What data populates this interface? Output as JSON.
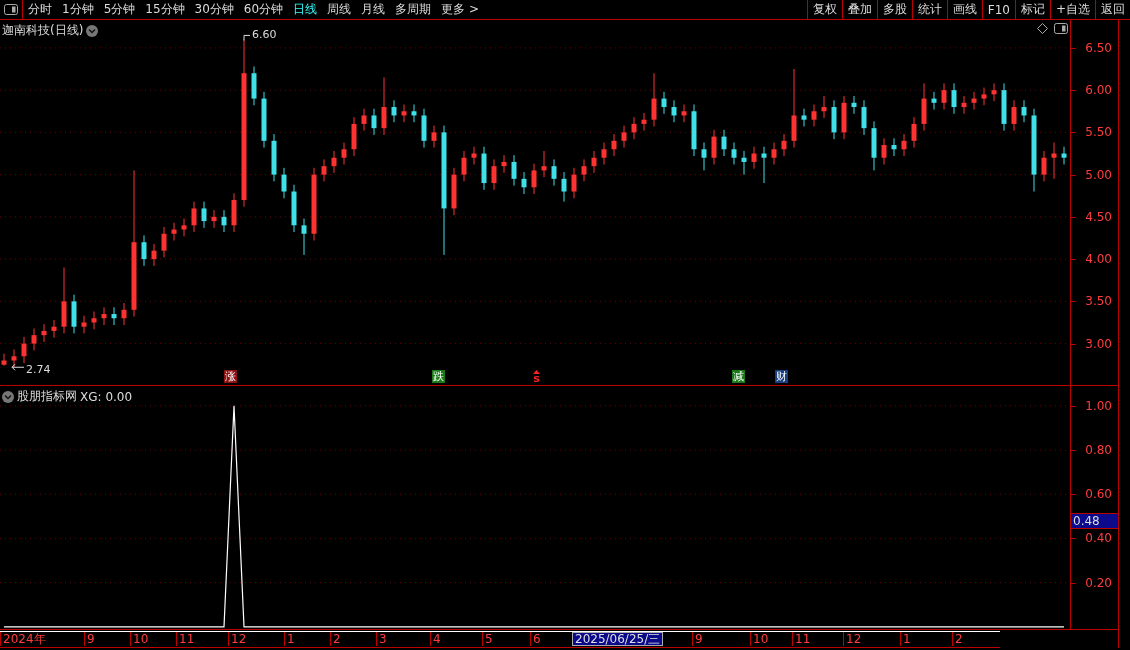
{
  "toolbar": {
    "periods": [
      {
        "label": "分时",
        "selected": false
      },
      {
        "label": "1分钟",
        "selected": false
      },
      {
        "label": "5分钟",
        "selected": false
      },
      {
        "label": "15分钟",
        "selected": false
      },
      {
        "label": "30分钟",
        "selected": false
      },
      {
        "label": "60分钟",
        "selected": false
      },
      {
        "label": "日线",
        "selected": true
      },
      {
        "label": "周线",
        "selected": false
      },
      {
        "label": "月线",
        "selected": false
      },
      {
        "label": "多周期",
        "selected": false
      },
      {
        "label": "更多 >",
        "selected": false
      }
    ],
    "buttons": [
      "复权",
      "叠加",
      "多股",
      "统计",
      "画线",
      "F10",
      "标记",
      "+自选",
      "返回"
    ]
  },
  "price_panel": {
    "title": "迦南科技(日线)",
    "high_label": "6.60",
    "low_label": "2.74",
    "markers": [
      {
        "text": "涨",
        "kind": "tag",
        "color": "#8b1010"
      },
      {
        "text": "跌",
        "kind": "tag",
        "color": "#1a7a1a"
      },
      {
        "text": "s",
        "kind": "arrow",
        "color": "#ff2020"
      },
      {
        "text": "减",
        "kind": "tag",
        "color": "#1a7a1a"
      },
      {
        "text": "财",
        "kind": "tag",
        "color": "#1a3f80"
      }
    ],
    "chart_data": {
      "type": "candlestick",
      "grid": true,
      "ylim": [
        2.51,
        6.83
      ],
      "yticks": [
        {
          "value": 3,
          "label": "3.00"
        },
        {
          "value": 3.5,
          "label": "3.50"
        },
        {
          "value": 4,
          "label": "4.00"
        },
        {
          "value": 4.5,
          "label": "4.50"
        },
        {
          "value": 5,
          "label": "5.00"
        },
        {
          "value": 5.5,
          "label": "5.50"
        },
        {
          "value": 6,
          "label": "6.00"
        },
        {
          "value": 6.5,
          "label": "6.50"
        }
      ],
      "ohlc": [
        [
          2.75,
          2.88,
          2.74,
          2.8
        ],
        [
          2.8,
          2.93,
          2.72,
          2.85
        ],
        [
          2.85,
          3.08,
          2.77,
          3.0
        ],
        [
          3.0,
          3.18,
          2.92,
          3.1
        ],
        [
          3.1,
          3.23,
          3.02,
          3.15
        ],
        [
          3.15,
          3.28,
          3.07,
          3.2
        ],
        [
          3.2,
          3.9,
          3.12,
          3.5
        ],
        [
          3.5,
          3.58,
          3.12,
          3.2
        ],
        [
          3.2,
          3.33,
          3.12,
          3.25
        ],
        [
          3.25,
          3.38,
          3.17,
          3.3
        ],
        [
          3.3,
          3.43,
          3.22,
          3.35
        ],
        [
          3.35,
          3.43,
          3.22,
          3.3
        ],
        [
          3.3,
          3.48,
          3.22,
          3.4
        ],
        [
          3.4,
          5.05,
          3.32,
          4.2
        ],
        [
          4.2,
          4.28,
          3.92,
          4.0
        ],
        [
          4.0,
          4.18,
          3.92,
          4.1
        ],
        [
          4.1,
          4.38,
          4.02,
          4.3
        ],
        [
          4.3,
          4.43,
          4.22,
          4.35
        ],
        [
          4.35,
          4.48,
          4.27,
          4.4
        ],
        [
          4.4,
          4.68,
          4.32,
          4.6
        ],
        [
          4.6,
          4.68,
          4.37,
          4.45
        ],
        [
          4.45,
          4.58,
          4.37,
          4.5
        ],
        [
          4.5,
          4.58,
          4.32,
          4.4
        ],
        [
          4.4,
          4.78,
          4.32,
          4.7
        ],
        [
          4.7,
          6.6,
          4.62,
          6.2
        ],
        [
          6.2,
          6.28,
          5.82,
          5.9
        ],
        [
          5.9,
          5.98,
          5.32,
          5.4
        ],
        [
          5.4,
          5.48,
          4.92,
          5.0
        ],
        [
          5.0,
          5.08,
          4.72,
          4.8
        ],
        [
          4.8,
          4.88,
          4.32,
          4.4
        ],
        [
          4.4,
          4.48,
          4.05,
          4.3
        ],
        [
          4.3,
          5.08,
          4.22,
          5.0
        ],
        [
          5.0,
          5.18,
          4.92,
          5.1
        ],
        [
          5.1,
          5.28,
          5.02,
          5.2
        ],
        [
          5.2,
          5.38,
          5.12,
          5.3
        ],
        [
          5.3,
          5.68,
          5.22,
          5.6
        ],
        [
          5.6,
          5.78,
          5.52,
          5.7
        ],
        [
          5.7,
          5.78,
          5.47,
          5.55
        ],
        [
          5.55,
          6.15,
          5.47,
          5.8
        ],
        [
          5.8,
          5.88,
          5.62,
          5.7
        ],
        [
          5.7,
          5.83,
          5.62,
          5.75
        ],
        [
          5.75,
          5.83,
          5.62,
          5.7
        ],
        [
          5.7,
          5.78,
          5.32,
          5.4
        ],
        [
          5.4,
          5.58,
          5.32,
          5.5
        ],
        [
          5.5,
          5.58,
          4.05,
          4.6
        ],
        [
          4.6,
          5.08,
          4.52,
          5.0
        ],
        [
          5.0,
          5.28,
          4.92,
          5.2
        ],
        [
          5.2,
          5.33,
          5.12,
          5.25
        ],
        [
          5.25,
          5.33,
          4.82,
          4.9
        ],
        [
          4.9,
          5.18,
          4.82,
          5.1
        ],
        [
          5.1,
          5.23,
          5.02,
          5.15
        ],
        [
          5.15,
          5.23,
          4.87,
          4.95
        ],
        [
          4.95,
          5.03,
          4.77,
          4.85
        ],
        [
          4.85,
          5.13,
          4.77,
          5.05
        ],
        [
          5.05,
          5.28,
          4.97,
          5.1
        ],
        [
          5.1,
          5.18,
          4.87,
          4.95
        ],
        [
          4.95,
          5.03,
          4.68,
          4.8
        ],
        [
          4.8,
          5.08,
          4.72,
          5.0
        ],
        [
          5.0,
          5.18,
          4.92,
          5.1
        ],
        [
          5.1,
          5.28,
          5.02,
          5.2
        ],
        [
          5.2,
          5.38,
          5.12,
          5.3
        ],
        [
          5.3,
          5.48,
          5.22,
          5.4
        ],
        [
          5.4,
          5.58,
          5.32,
          5.5
        ],
        [
          5.5,
          5.68,
          5.42,
          5.6
        ],
        [
          5.6,
          5.73,
          5.52,
          5.65
        ],
        [
          5.65,
          6.2,
          5.57,
          5.9
        ],
        [
          5.9,
          5.98,
          5.72,
          5.8
        ],
        [
          5.8,
          5.88,
          5.62,
          5.7
        ],
        [
          5.7,
          5.83,
          5.62,
          5.75
        ],
        [
          5.75,
          5.83,
          5.22,
          5.3
        ],
        [
          5.3,
          5.38,
          5.05,
          5.2
        ],
        [
          5.2,
          5.53,
          5.12,
          5.45
        ],
        [
          5.45,
          5.53,
          5.22,
          5.3
        ],
        [
          5.3,
          5.38,
          5.12,
          5.2
        ],
        [
          5.2,
          5.28,
          5.0,
          5.15
        ],
        [
          5.15,
          5.33,
          5.07,
          5.25
        ],
        [
          5.25,
          5.33,
          4.9,
          5.2
        ],
        [
          5.2,
          5.38,
          5.12,
          5.3
        ],
        [
          5.3,
          5.48,
          5.22,
          5.4
        ],
        [
          5.4,
          6.25,
          5.32,
          5.7
        ],
        [
          5.7,
          5.78,
          5.57,
          5.65
        ],
        [
          5.65,
          5.83,
          5.57,
          5.75
        ],
        [
          5.75,
          5.93,
          5.67,
          5.8
        ],
        [
          5.8,
          5.88,
          5.42,
          5.5
        ],
        [
          5.5,
          5.93,
          5.42,
          5.85
        ],
        [
          5.85,
          5.93,
          5.72,
          5.8
        ],
        [
          5.8,
          5.88,
          5.47,
          5.55
        ],
        [
          5.55,
          5.63,
          5.05,
          5.2
        ],
        [
          5.2,
          5.43,
          5.12,
          5.35
        ],
        [
          5.35,
          5.43,
          5.22,
          5.3
        ],
        [
          5.3,
          5.48,
          5.22,
          5.4
        ],
        [
          5.4,
          5.68,
          5.32,
          5.6
        ],
        [
          5.6,
          6.08,
          5.52,
          5.9
        ],
        [
          5.9,
          5.98,
          5.77,
          5.85
        ],
        [
          5.85,
          6.08,
          5.77,
          6.0
        ],
        [
          6.0,
          6.08,
          5.72,
          5.8
        ],
        [
          5.8,
          5.93,
          5.72,
          5.85
        ],
        [
          5.85,
          5.98,
          5.77,
          5.9
        ],
        [
          5.9,
          6.03,
          5.82,
          5.95
        ],
        [
          5.95,
          6.08,
          5.87,
          6.0
        ],
        [
          6.0,
          6.08,
          5.52,
          5.6
        ],
        [
          5.6,
          5.88,
          5.52,
          5.8
        ],
        [
          5.8,
          5.88,
          5.62,
          5.7
        ],
        [
          5.7,
          5.78,
          4.8,
          5.0
        ],
        [
          5.0,
          5.28,
          4.92,
          5.2
        ],
        [
          5.2,
          5.38,
          4.95,
          5.25
        ],
        [
          5.25,
          5.33,
          5.12,
          5.2
        ]
      ]
    }
  },
  "indicator_panel": {
    "name": "股朋指标网",
    "reading": "XG: 0.00",
    "current_value": "0.48",
    "chart_data": {
      "type": "line",
      "grid": true,
      "ylim": [
        -0.01,
        1.09
      ],
      "yticks": [
        {
          "value": 0.2,
          "label": "0.20"
        },
        {
          "value": 0.4,
          "label": "0.40"
        },
        {
          "value": 0.6,
          "label": "0.60"
        },
        {
          "value": 0.8,
          "label": "0.80"
        },
        {
          "value": 1,
          "label": "1.00"
        }
      ],
      "series": [
        {
          "color": "#ffffff",
          "values": [
            0,
            0,
            0,
            0,
            0,
            0,
            0,
            0,
            0,
            0,
            0,
            0,
            0,
            0,
            0,
            0,
            0,
            0,
            0,
            0,
            0,
            0,
            0,
            1,
            0,
            0,
            0,
            0,
            0,
            0,
            0,
            0,
            0,
            0,
            0,
            0,
            0,
            0,
            0,
            0,
            0,
            0,
            0,
            0,
            0,
            0,
            0,
            0,
            0,
            0,
            0,
            0,
            0,
            0,
            0,
            0,
            0,
            0,
            0,
            0,
            0,
            0,
            0,
            0,
            0,
            0,
            0,
            0,
            0,
            0,
            0,
            0,
            0,
            0,
            0,
            0,
            0,
            0,
            0,
            0,
            0,
            0,
            0,
            0,
            0,
            0,
            0,
            0,
            0,
            0,
            0,
            0,
            0,
            0,
            0,
            0,
            0,
            0,
            0,
            0,
            0,
            0,
            0,
            0,
            0,
            0,
            0
          ]
        }
      ]
    }
  },
  "time_axis": [
    {
      "label": "2024年",
      "selected": false
    },
    {
      "label": "9",
      "selected": false
    },
    {
      "label": "10",
      "selected": false
    },
    {
      "label": "11",
      "selected": false
    },
    {
      "label": "12",
      "selected": false
    },
    {
      "label": "1",
      "selected": false
    },
    {
      "label": "2",
      "selected": false
    },
    {
      "label": "3",
      "selected": false
    },
    {
      "label": "4",
      "selected": false
    },
    {
      "label": "5",
      "selected": false
    },
    {
      "label": "6",
      "selected": false
    },
    {
      "label": "2025/06/25/三",
      "selected": true
    },
    {
      "label": "9",
      "selected": false
    },
    {
      "label": "10",
      "selected": false
    },
    {
      "label": "11",
      "selected": false
    },
    {
      "label": "12",
      "selected": false
    },
    {
      "label": "1",
      "selected": false
    },
    {
      "label": "2",
      "selected": false
    }
  ]
}
